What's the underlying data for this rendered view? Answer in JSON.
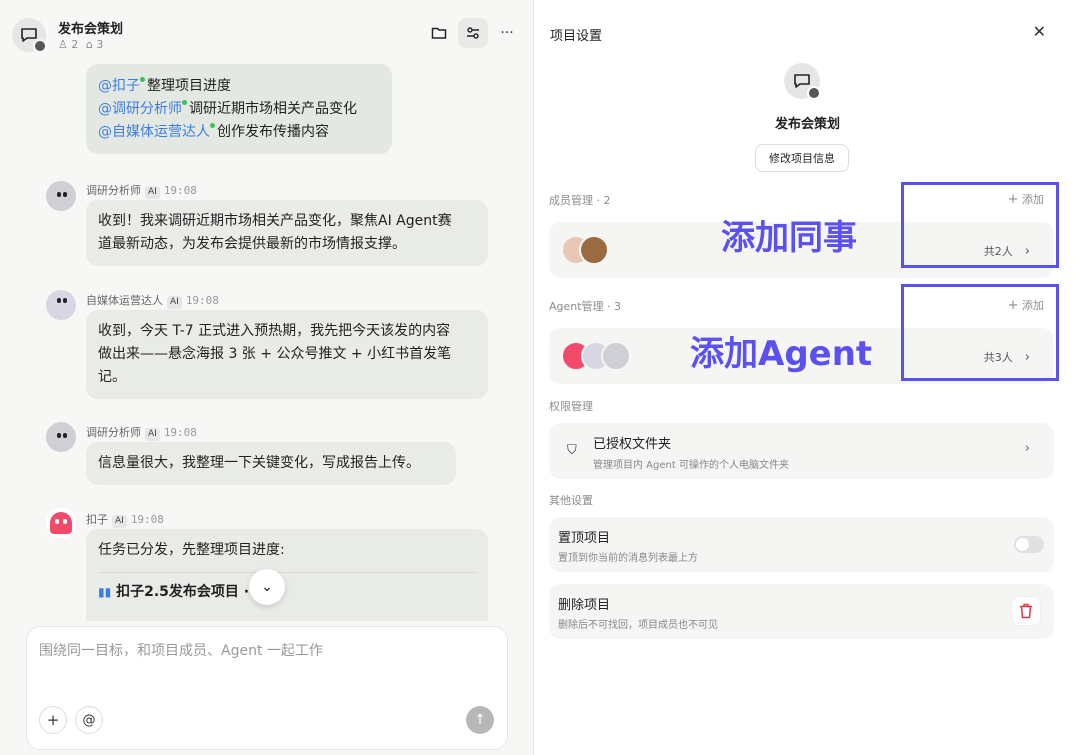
{
  "chat": {
    "project_title": "发布会策划",
    "member_count": "2",
    "agent_count": "3",
    "mention_list": [
      {
        "name": "@扣子",
        "task": "整理项目进度"
      },
      {
        "name": "@调研分析师",
        "task": "调研近期市场相关产品变化"
      },
      {
        "name": "@自媒体运营达人",
        "task": "创作发布传播内容"
      }
    ],
    "messages": [
      {
        "sender": "调研分析师",
        "tag": "AI",
        "time": "19:08",
        "lines": [
          "收到！我来调研近期市场相关产品变化，聚焦AI Agent赛",
          "道最新动态，为发布会提供最新的市场情报支撑。"
        ]
      },
      {
        "sender": "自媒体运营达人",
        "tag": "AI",
        "time": "19:08",
        "lines": [
          "收到，今天 T-7 正式进入预热期，我先把今天该发的内容",
          "做出来——悬念海报 3 张 + 公众号推文 + 小红书首发笔",
          "记。"
        ]
      },
      {
        "sender": "调研分析师",
        "tag": "AI",
        "time": "19:08",
        "lines": [
          "信息量很大，我整理一下关键变化，写成报告上传。"
        ]
      },
      {
        "sender": "扣子",
        "tag": "AI",
        "time": "19:08",
        "lines": [
          "任务已分发，先整理项目进度:"
        ],
        "board_title": "扣子2.5发布会项目 · 看板"
      }
    ],
    "composer_placeholder": "围绕同一目标，和项目成员、Agent 一起工作"
  },
  "settings": {
    "title": "项目设置",
    "project_name": "发布会策划",
    "edit_button": "修改项目信息",
    "members_section": "成员管理 · 2",
    "add_label": "添加",
    "members_count": "共2人",
    "agents_section": "Agent管理 · 3",
    "agents_count": "共3人",
    "permissions_section": "权限管理",
    "folder_title": "已授权文件夹",
    "folder_desc": "管理项目内 Agent 可操作的个人电脑文件夹",
    "other_section": "其他设置",
    "pin_title": "置顶项目",
    "pin_desc": "置顶到你当前的消息列表最上方",
    "pin_enabled": false,
    "delete_title": "删除项目",
    "delete_desc": "删除后不可找回，项目成员也不可见"
  },
  "annotations": {
    "add_colleague": "添加同事",
    "add_agent": "添加Agent"
  },
  "colors": {
    "accent": "#5b50f0",
    "mention": "#3c7ee0",
    "danger": "#e0383e",
    "online": "#3cc15a"
  }
}
